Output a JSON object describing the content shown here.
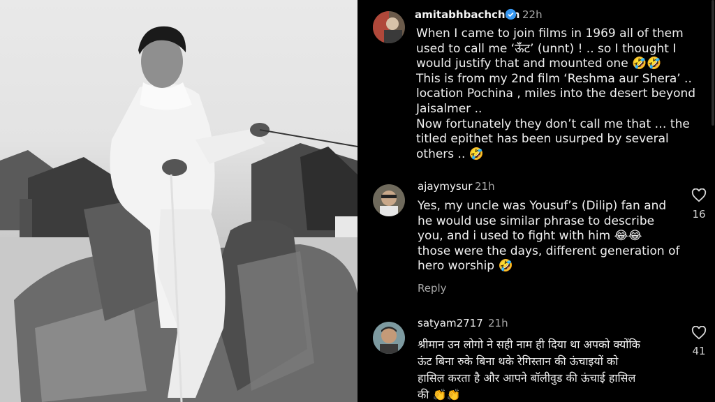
{
  "post_comment": {
    "username": "amitabhbachchan",
    "verified": true,
    "time": "22h",
    "text": "When I came to join films in 1969 all of them\nused to call me ‘ऊँट’ (unnt) ! .. so I thought I\nwould justify that and mounted one 🤣🤣\nThis is from my 2nd film ‘Reshma aur Shera’ ..\nlocation Pochina , miles into the desert beyond\nJaisalmer ..\nNow fortunately they don’t call me that … the\ntitled epithet has been usurped by several\nothers .. 🤣"
  },
  "comments": [
    {
      "username": "ajaymysur",
      "time": "21h",
      "text": "Yes, my uncle was Yousuf’s (Dilip) fan and\nhe would use similar phrase to describe\nyou, and i used to fight with him 😂😂\nthose were the days, different generation of\nhero worship 🤣",
      "reply_label": "Reply",
      "likes": "16"
    },
    {
      "username": "satyam2717",
      "time": "21h",
      "text": "श्रीमान उन लोगो ने सही नाम ही दिया था अपको क्योंकि\nऊंट बिना रुके बिना थके रेगिस्तान की ऊंचाइयों को\nहासिल करता है और आपने बॉलीवुड की ऊंचाई हासिल\nकी 👏👏",
      "likes": "41"
    }
  ],
  "colors": {
    "background": "#000000",
    "text": "#f2f2f2",
    "muted": "#a8a8a8",
    "verified": "#3797f0"
  },
  "icons": {
    "verified": "verified-badge-icon",
    "like": "heart-outline-icon"
  }
}
